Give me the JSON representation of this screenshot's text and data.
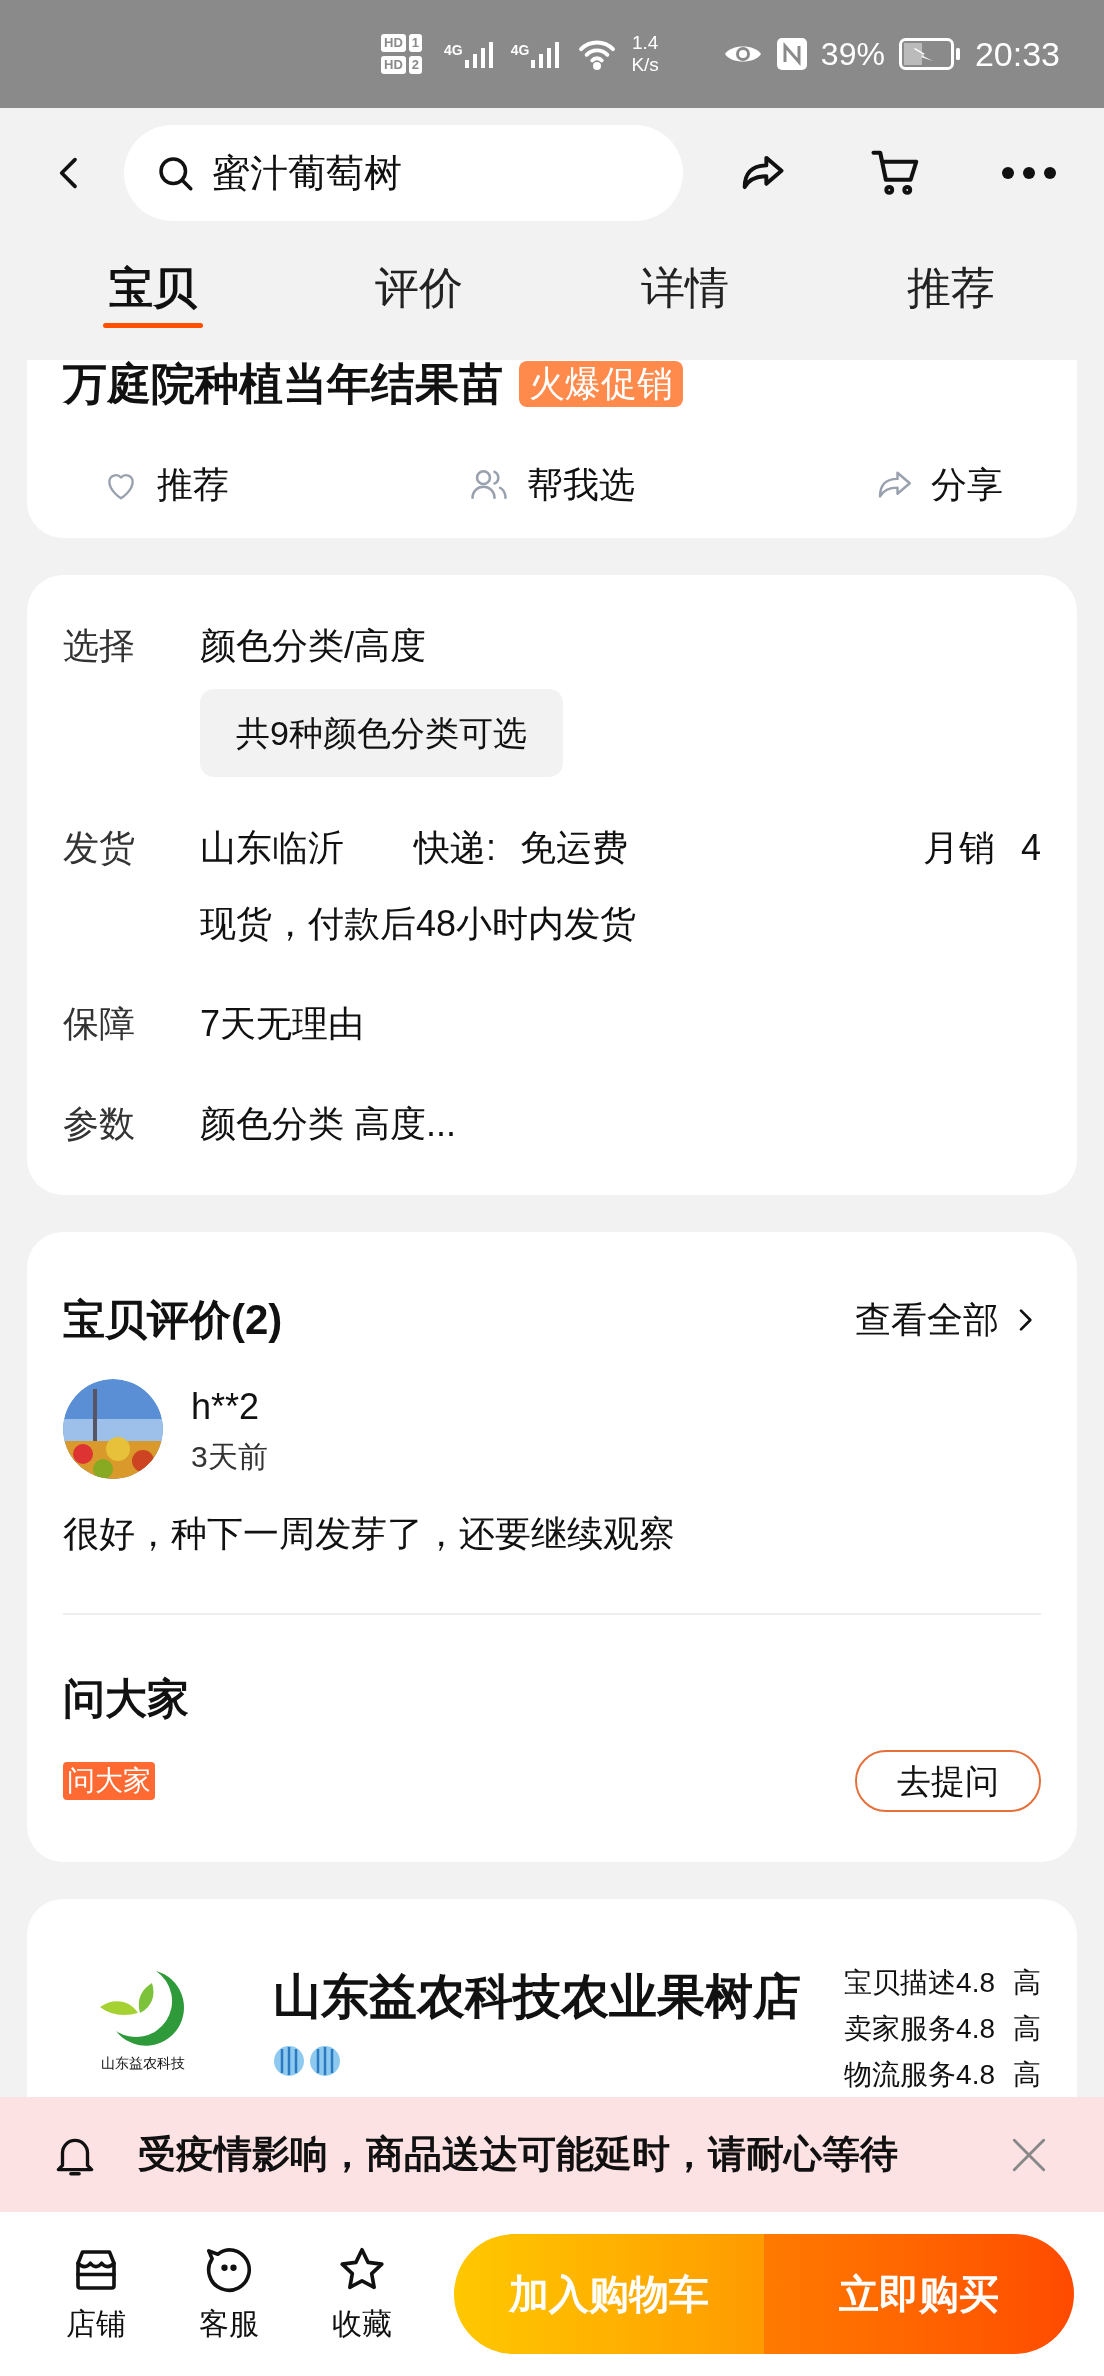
{
  "status_bar": {
    "sims": [
      {
        "label": "HD",
        "slot": "1"
      },
      {
        "label": "HD",
        "slot": "2"
      }
    ],
    "networks": [
      "4G",
      "4G"
    ],
    "speed": "1.4",
    "speed_unit": "K/s",
    "battery": "39%",
    "time": "20:33"
  },
  "header": {
    "search": {
      "value": "蜜汁葡萄树"
    }
  },
  "tabs": [
    {
      "label": "宝贝",
      "selected": true
    },
    {
      "label": "评价",
      "selected": false
    },
    {
      "label": "详情",
      "selected": false
    },
    {
      "label": "推荐",
      "selected": false
    }
  ],
  "product": {
    "title": "万庭院种植当年结果苗",
    "badge": "火爆促销",
    "actions": [
      {
        "kind": "heart",
        "label": "推荐"
      },
      {
        "kind": "people",
        "label": "帮我选"
      },
      {
        "kind": "share",
        "label": "分享"
      }
    ]
  },
  "specs": {
    "choose": {
      "label": "选择",
      "value": "颜色分类/高度",
      "chip": "共9种颜色分类可选"
    },
    "shipping": {
      "label": "发货",
      "origin": "山东临沂",
      "express": "快递:",
      "fee": "免运费",
      "sales_label": "月销",
      "sales": "4",
      "note": "现货，付款后48小时内发货"
    },
    "rows": [
      {
        "label": "保障",
        "value": "7天无理由"
      },
      {
        "label": "参数",
        "value": "颜色分类 高度..."
      }
    ]
  },
  "reviews": {
    "title": "宝贝评价(2)",
    "link": "查看全部",
    "items": [
      {
        "user": "h**2",
        "time": "3天前",
        "text": "很好，种下一周发芽了，还要继续观察"
      }
    ]
  },
  "ask": {
    "title": "问大家",
    "tag": "问大家",
    "button": "去提问"
  },
  "store": {
    "logo_text": "山东益农科技",
    "name": "山东益农科技农业果树店",
    "badges": [
      {
        "kind": "crown"
      },
      {
        "kind": "crown"
      }
    ],
    "ratings": [
      {
        "label": "宝贝描述",
        "score": "4.8",
        "level": "高"
      },
      {
        "label": "卖家服务",
        "score": "4.8",
        "level": "高"
      },
      {
        "label": "物流服务",
        "score": "4.8",
        "level": "高"
      }
    ]
  },
  "notice": {
    "text": "受疫情影响，商品送达可能延时，请耐心等待"
  },
  "bottom_bar": {
    "nav": [
      {
        "kind": "store",
        "label": "店铺"
      },
      {
        "kind": "service",
        "label": "客服"
      },
      {
        "kind": "star",
        "label": "收藏"
      }
    ],
    "cart_button": "加入购物车",
    "buy_button": "立即购买"
  }
}
